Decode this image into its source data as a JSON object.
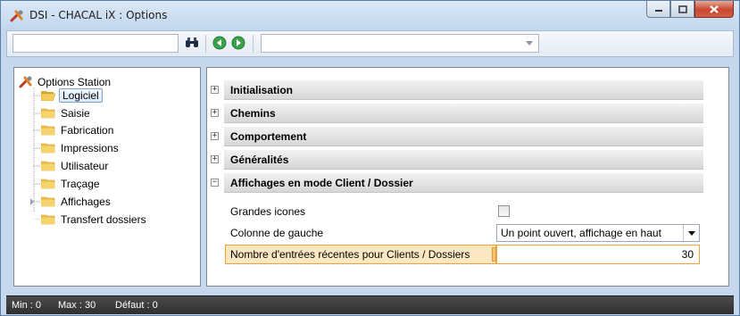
{
  "window": {
    "title": "DSI - CHACAL iX : Options",
    "colors": {
      "close": "#c8452e",
      "accent": "#e9a43d",
      "selection": "#fbe8c2",
      "chrome": "#c5d8ee"
    }
  },
  "toolbar": {
    "search_value": "",
    "search_icon": "binoculars-icon",
    "back_icon": "back-arrow-icon",
    "forward_icon": "forward-arrow-icon",
    "combo_value": ""
  },
  "tree": {
    "root": {
      "label": "Options Station",
      "icon": "tools-icon"
    },
    "items": [
      {
        "label": "Logiciel",
        "selected": true,
        "icon": "folder-open-icon"
      },
      {
        "label": "Saisie",
        "icon": "folder-icon"
      },
      {
        "label": "Fabrication",
        "icon": "folder-icon"
      },
      {
        "label": "Impressions",
        "icon": "folder-icon"
      },
      {
        "label": "Utilisateur",
        "icon": "folder-icon"
      },
      {
        "label": "Traçage",
        "icon": "folder-icon"
      },
      {
        "label": "Affichages",
        "icon": "folder-icon",
        "expandable": true
      },
      {
        "label": "Transfert dossiers",
        "icon": "folder-icon"
      }
    ]
  },
  "properties": {
    "categories": [
      {
        "name": "Initialisation",
        "expanded": false,
        "toggle": "+"
      },
      {
        "name": "Chemins",
        "expanded": false,
        "toggle": "+"
      },
      {
        "name": "Comportement",
        "expanded": false,
        "toggle": "+"
      },
      {
        "name": "Généralités",
        "expanded": false,
        "toggle": "+"
      },
      {
        "name": "Affichages en mode Client / Dossier",
        "expanded": true,
        "toggle": "−"
      }
    ],
    "rows": [
      {
        "name": "Grandes icones",
        "type": "checkbox",
        "checked": false
      },
      {
        "name": "Colonne de gauche",
        "type": "dropdown",
        "value": "Un point ouvert, affichage en haut"
      },
      {
        "name": "Nombre d'entrées récentes pour Clients / Dossiers",
        "type": "number",
        "value": "30",
        "selected": true
      }
    ]
  },
  "status": {
    "min": "Min : 0",
    "max": "Max : 30",
    "default": "Défaut : 0"
  }
}
